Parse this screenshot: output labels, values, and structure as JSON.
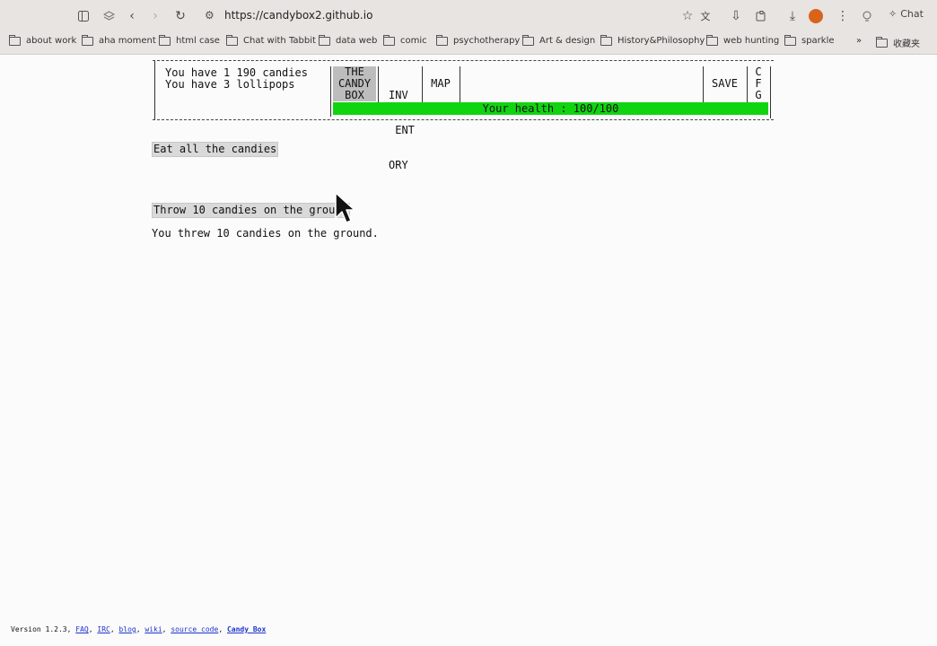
{
  "browser": {
    "url": "https://candybox2.github.io",
    "chat_label": "Chat",
    "bookmarks": [
      "about work",
      "aha moment",
      "html case",
      "Chat with Tabbit",
      "data web",
      "comic",
      "psychotherapy",
      "Art & design",
      "History&Philosophy",
      "web hunting",
      "sparkle"
    ],
    "bookmarks_overflow": "»",
    "bookmarks_folder": "收藏夹"
  },
  "game": {
    "status_line1": "You have 1 190 candies",
    "status_line2": "You have 3 lollipops",
    "tabs": {
      "candy_box": [
        "THE",
        "CANDY",
        "BOX"
      ],
      "inventory": [
        "INV",
        " ENT",
        "ORY"
      ],
      "map": "MAP",
      "save": "SAVE",
      "cfg": [
        "C",
        "F",
        "G"
      ]
    },
    "health_text": "Your health : 100/100",
    "health_color": "#11d411",
    "actions": {
      "eat": "Eat all the candies",
      "throw": "Throw 10 candies on the ground"
    },
    "message": "You threw 10 candies on the ground."
  },
  "footer": {
    "version": "Version 1.2.3,",
    "links": [
      "FAQ",
      "IRC",
      "blog",
      "wiki",
      "source code"
    ],
    "bold_link": "Candy Box",
    "separator": ","
  }
}
